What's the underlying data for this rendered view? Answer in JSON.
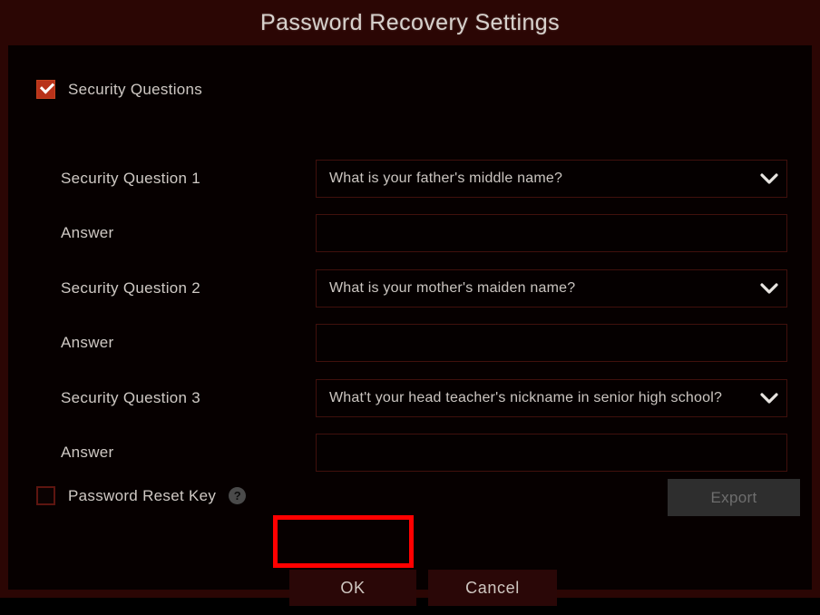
{
  "dialog": {
    "title": "Password Recovery Settings"
  },
  "security_questions": {
    "checkbox_label": "Security Questions",
    "checked": true,
    "rows": [
      {
        "label": "Security Question 1",
        "type": "select",
        "value": "What is your father's middle name?",
        "icon": "chevron-down-icon"
      },
      {
        "label": "Answer",
        "type": "input",
        "value": "",
        "placeholder": ""
      },
      {
        "label": "Security Question 2",
        "type": "select",
        "value": "What is your mother's maiden name?",
        "icon": "chevron-down-icon"
      },
      {
        "label": "Answer",
        "type": "input",
        "value": "",
        "placeholder": ""
      },
      {
        "label": "Security Question 3",
        "type": "select",
        "value": "What't your head teacher's nickname in senior high school?",
        "icon": "chevron-down-icon"
      },
      {
        "label": "Answer",
        "type": "input",
        "value": "",
        "placeholder": ""
      }
    ]
  },
  "password_reset_key": {
    "checkbox_label": "Password Reset Key",
    "checked": false,
    "help_icon": "help-icon",
    "help_glyph": "?",
    "export_label": "Export",
    "export_disabled": true
  },
  "footer": {
    "ok_label": "OK",
    "cancel_label": "Cancel"
  },
  "colors": {
    "titlebar": "#2b0604",
    "body": "#060000",
    "checkbox_checked": "#b8321a",
    "checkbox_border": "#5d1510",
    "field_border": "#40100c",
    "button_fill": "#2a0707",
    "export_fill": "#2e2e2e",
    "text": "#cfc9c4",
    "annotation": "#ff0000"
  }
}
